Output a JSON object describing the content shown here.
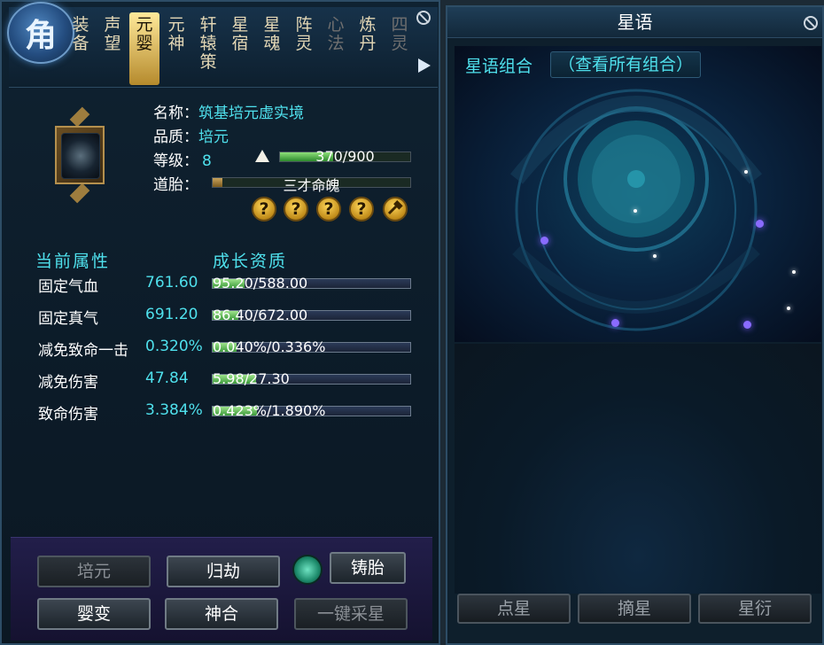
{
  "left_panel": {
    "role_badge": "角",
    "tabs": [
      {
        "label": "装备",
        "lines": [
          "装",
          "备"
        ],
        "state": "normal"
      },
      {
        "label": "声望",
        "lines": [
          "声",
          "望"
        ],
        "state": "normal"
      },
      {
        "label": "元婴",
        "lines": [
          "元",
          "婴"
        ],
        "state": "active"
      },
      {
        "label": "元神",
        "lines": [
          "元",
          "神"
        ],
        "state": "normal"
      },
      {
        "label": "轩辕策",
        "lines": [
          "轩",
          "辕",
          "策"
        ],
        "state": "normal"
      },
      {
        "label": "星宿",
        "lines": [
          "星",
          "宿"
        ],
        "state": "normal"
      },
      {
        "label": "星魂",
        "lines": [
          "星",
          "魂"
        ],
        "state": "normal"
      },
      {
        "label": "阵灵",
        "lines": [
          "阵",
          "灵"
        ],
        "state": "normal"
      },
      {
        "label": "心法",
        "lines": [
          "心",
          "法"
        ],
        "state": "dim"
      },
      {
        "label": "炼丹",
        "lines": [
          "炼",
          "丹"
        ],
        "state": "normal"
      },
      {
        "label": "四灵",
        "lines": [
          "四",
          "灵"
        ],
        "state": "dim"
      }
    ],
    "item": {
      "name_key": "名称：",
      "name_value": "筑基培元虚实境",
      "quality_key": "品质：",
      "quality_value": "培元",
      "level_key": "等级：",
      "level_value": "8",
      "exp_text": "370/900",
      "exp_current": 370,
      "exp_max": 900,
      "embryo_key": "道胎：",
      "embryo_text": "三才命魄",
      "embryo_fill": 0.05
    },
    "question_buttons": [
      "?",
      "?",
      "?",
      "?"
    ],
    "current_attr_title": "当前属性",
    "growth_title": "成长资质",
    "attributes": [
      {
        "name": "固定气血",
        "value": "761.60",
        "growth": "95.20/588.00",
        "fill": 0.162
      },
      {
        "name": "固定真气",
        "value": "691.20",
        "growth": "86.40/672.00",
        "fill": 0.129
      },
      {
        "name": "减免致命一击",
        "value": "0.320%",
        "growth": "0.040%/0.336%",
        "fill": 0.119
      },
      {
        "name": "减免伤害",
        "value": "47.84",
        "growth": "5.98/27.30",
        "fill": 0.219
      },
      {
        "name": "致命伤害",
        "value": "3.384%",
        "growth": "0.423%/1.890%",
        "fill": 0.224
      }
    ],
    "buttons": {
      "peiyuan": "培元",
      "guijie": "归劫",
      "zhutai": "铸胎",
      "yingbian": "婴变",
      "shenhe": "神合",
      "caixing": "一键采星"
    }
  },
  "right_panel": {
    "title": "星语",
    "combo_label": "星语组合",
    "combo_link": "（查看所有组合）",
    "buttons": [
      "点星",
      "摘星",
      "星衍"
    ]
  }
}
